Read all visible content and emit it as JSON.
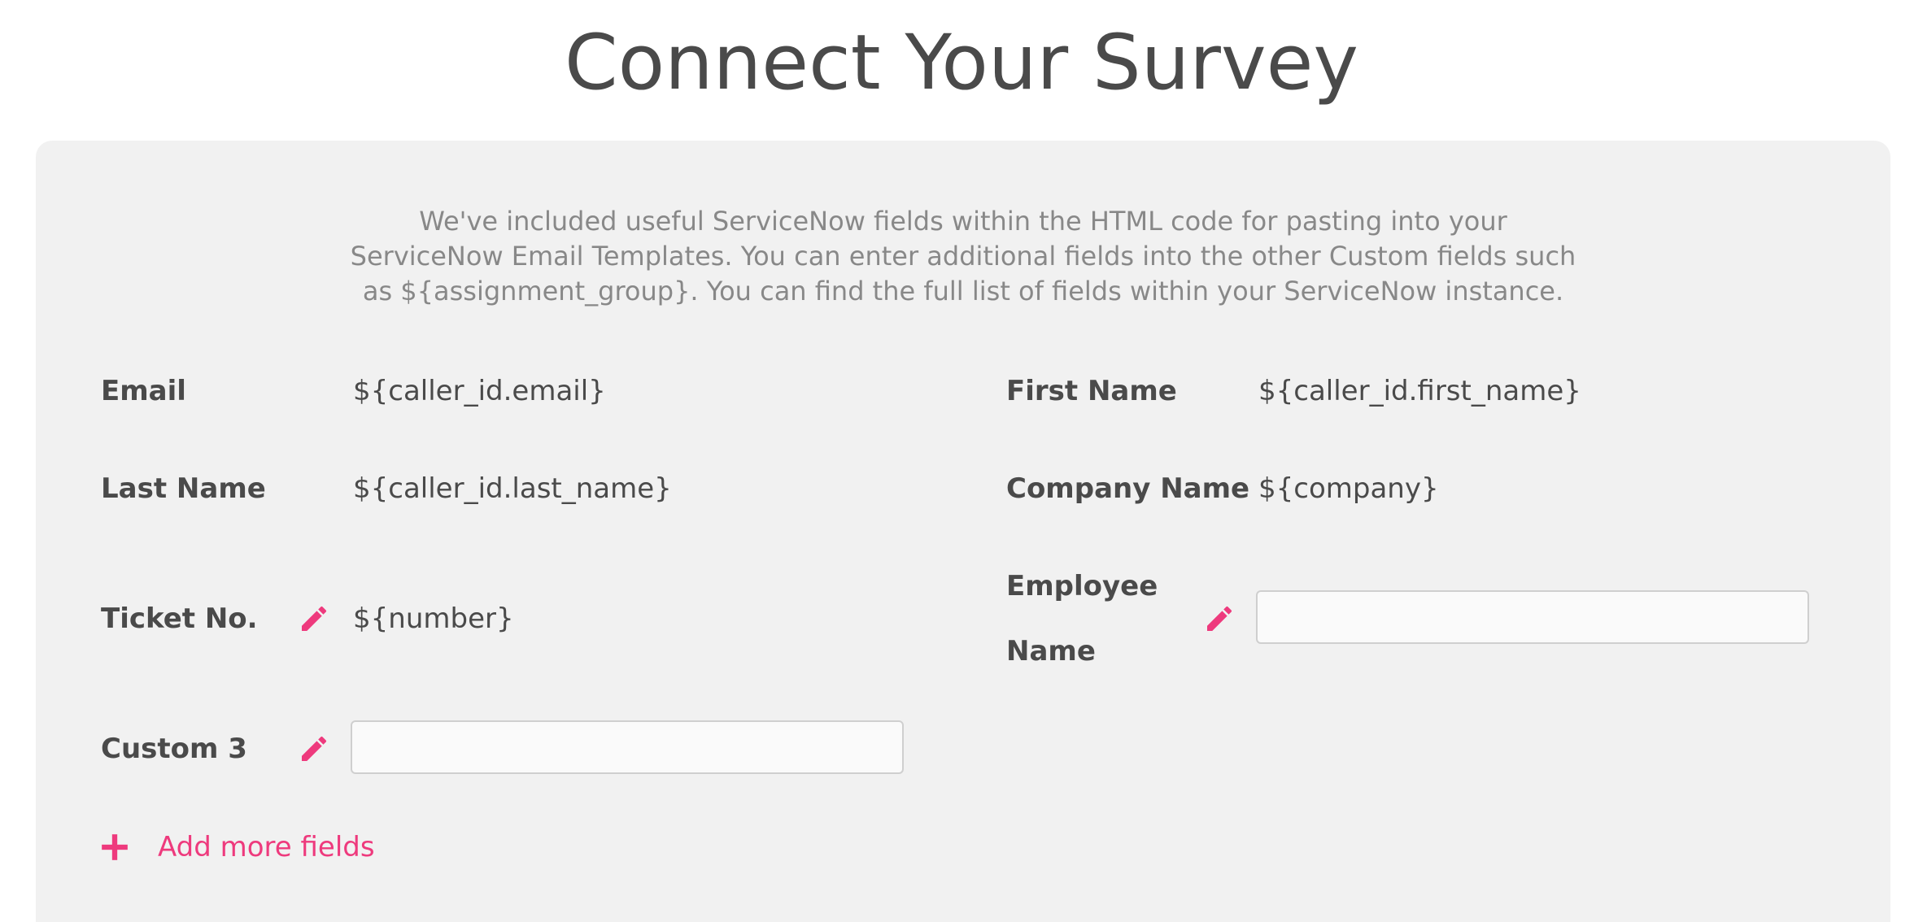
{
  "page": {
    "title": "Connect Your Survey"
  },
  "intro": {
    "text": "We've included useful ServiceNow fields within the HTML code for pasting into your ServiceNow Email Templates. You can enter additional fields into the other Custom fields such as ${assignment_group}. You can find the full list of fields within your ServiceNow instance."
  },
  "fields": {
    "email": {
      "label": "Email",
      "value": "${caller_id.email}"
    },
    "first_name": {
      "label": "First Name",
      "value": "${caller_id.first_name}"
    },
    "last_name": {
      "label": "Last Name",
      "value": "${caller_id.last_name}"
    },
    "company_name": {
      "label": "Company Name",
      "value": "${company}"
    },
    "ticket_no": {
      "label": "Ticket No.",
      "value": "${number}",
      "icon": "pencil-icon"
    },
    "employee_name": {
      "label": "Employee Name",
      "value": "",
      "icon": "pencil-icon"
    },
    "custom_3": {
      "label": "Custom 3",
      "value": "",
      "icon": "pencil-icon"
    }
  },
  "actions": {
    "add_more_label": "Add more fields",
    "add_icon": "plus-icon"
  },
  "colors": {
    "accent": "#ee3a7d",
    "text": "#4a4a4a",
    "muted": "#888888",
    "panel": "#f1f1f1"
  }
}
